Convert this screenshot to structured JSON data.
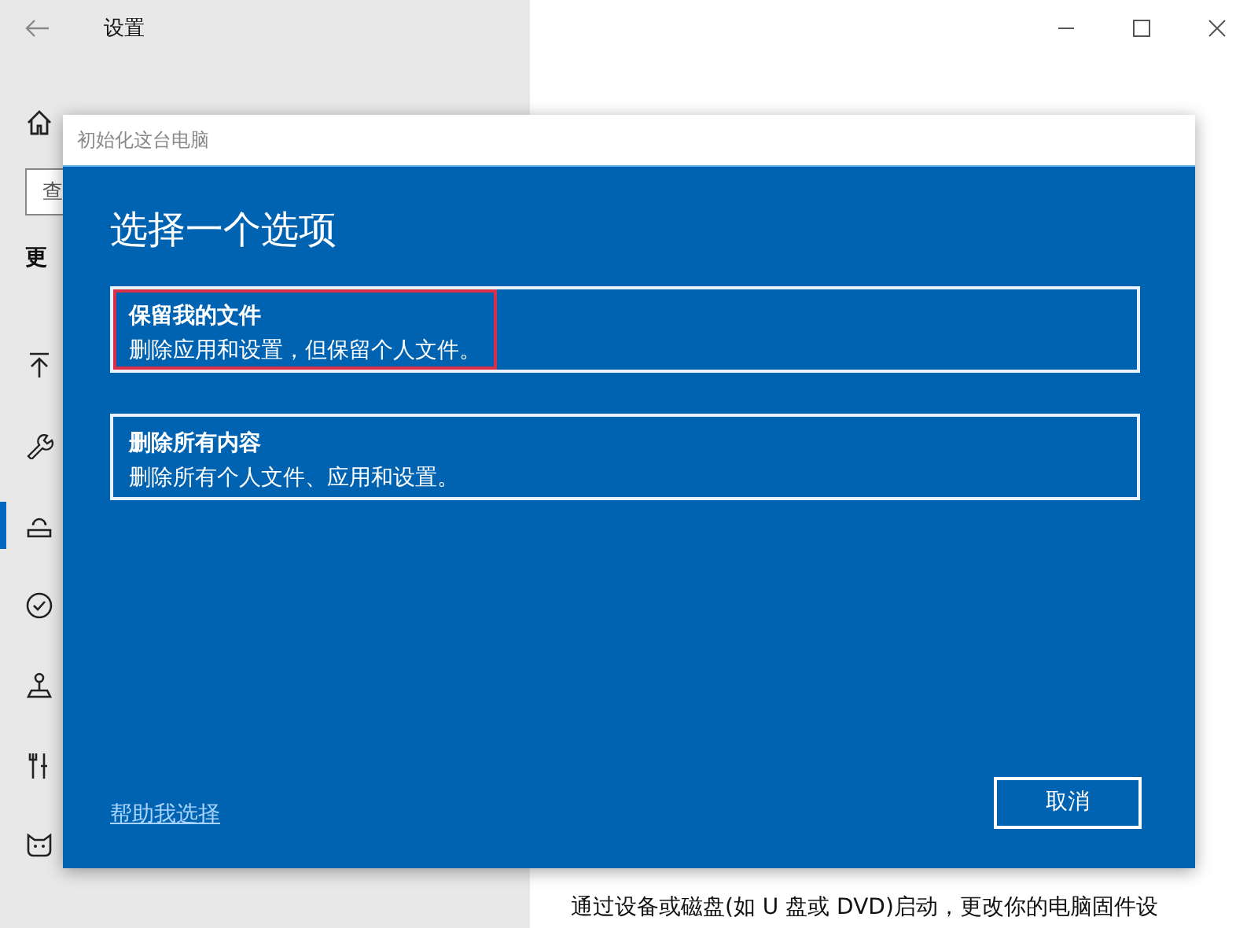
{
  "window": {
    "title": "设置"
  },
  "sidebar": {
    "search": {
      "placeholder": "查"
    },
    "section_title": "更",
    "items": [
      {
        "kind": "upload",
        "selected": false
      },
      {
        "kind": "wrench",
        "selected": false
      },
      {
        "kind": "backup",
        "selected": true
      },
      {
        "kind": "check",
        "selected": false
      },
      {
        "kind": "person",
        "selected": false
      },
      {
        "kind": "tools",
        "selected": false
      },
      {
        "kind": "cat",
        "selected": false
      }
    ]
  },
  "main": {
    "body": "通过设备或磁盘(如 U 盘或 DVD)启动，更改你的电脑固件设"
  },
  "dialog": {
    "title": "初始化这台电脑",
    "heading": "选择一个选项",
    "options": [
      {
        "title": "保留我的文件",
        "description": "删除应用和设置，但保留个人文件。",
        "highlighted": true
      },
      {
        "title": "删除所有内容",
        "description": "删除所有个人文件、应用和设置。",
        "highlighted": false
      }
    ],
    "help_link": "帮助我选择",
    "cancel": "取消"
  }
}
